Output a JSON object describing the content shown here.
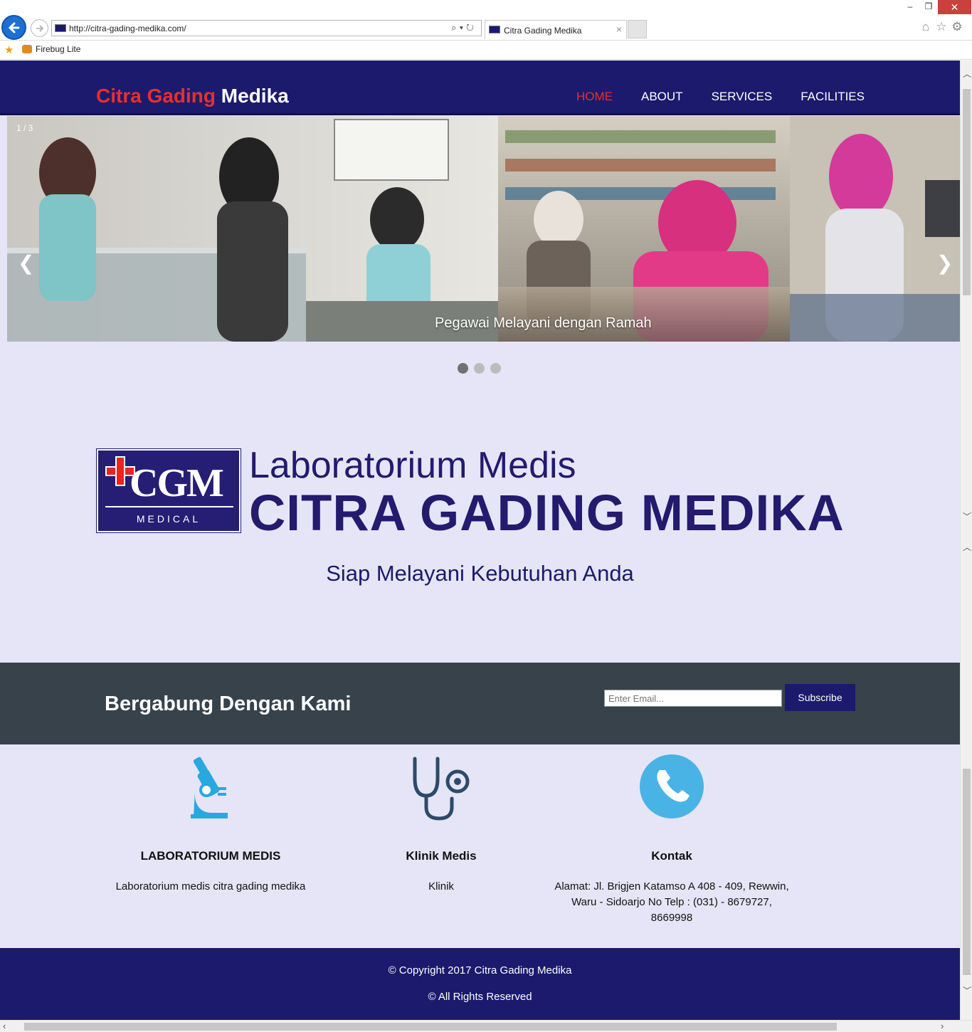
{
  "browser": {
    "url": "http://citra-gading-medika.com/",
    "tab_title": "Citra Gading Medika",
    "tab_close": "×",
    "favorites_item": "Firebug Lite",
    "window_buttons": {
      "minimize": "–",
      "restore": "❐",
      "close": "✕"
    },
    "icons": [
      "home-icon",
      "star-icon",
      "gear-icon"
    ]
  },
  "navbar": {
    "brand_part1": "Citra Gading",
    "brand_part2": "Medika",
    "items": [
      {
        "label": "HOME",
        "active": true
      },
      {
        "label": "ABOUT",
        "active": false
      },
      {
        "label": "SERVICES",
        "active": false
      },
      {
        "label": "FACILITIES",
        "active": false
      }
    ]
  },
  "carousel": {
    "counter": "1 / 3",
    "caption": "Pegawai Melayani dengan Ramah",
    "prev": "❮",
    "next": "❯",
    "current_slide": 1,
    "slide_count": 3
  },
  "hero": {
    "logo_text": "CGM",
    "logo_subtext": "MEDICAL",
    "title": "Laboratorium Medis",
    "name": "CITRA GADING MEDIKA",
    "tagline": "Siap Melayani Kebutuhan Anda"
  },
  "subscribe": {
    "title": "Bergabung Dengan Kami",
    "email_placeholder": "Enter Email...",
    "button_label": "Subscribe"
  },
  "features": [
    {
      "icon": "microscope-icon",
      "title": "LABORATORIUM MEDIS",
      "desc": "Laboratorium medis citra gading medika"
    },
    {
      "icon": "stethoscope-icon",
      "title": "Klinik Medis",
      "desc": "Klinik"
    },
    {
      "icon": "phone-icon",
      "title": "Kontak",
      "desc": "Alamat: Jl. Brigjen Katamso A 408 - 409, Rewwin, Waru - Sidoarjo No Telp : (031) - 8679727, 8669998"
    }
  ],
  "footer": {
    "copyright": "© Copyright 2017 Citra Gading Medika",
    "rights": "© All Rights Reserved"
  },
  "colors": {
    "navy": "#1c1a6c",
    "accent_red": "#e53030",
    "page_bg": "#e6e5f7",
    "band_bg": "#37424b",
    "icon_blue": "#29a8df"
  }
}
